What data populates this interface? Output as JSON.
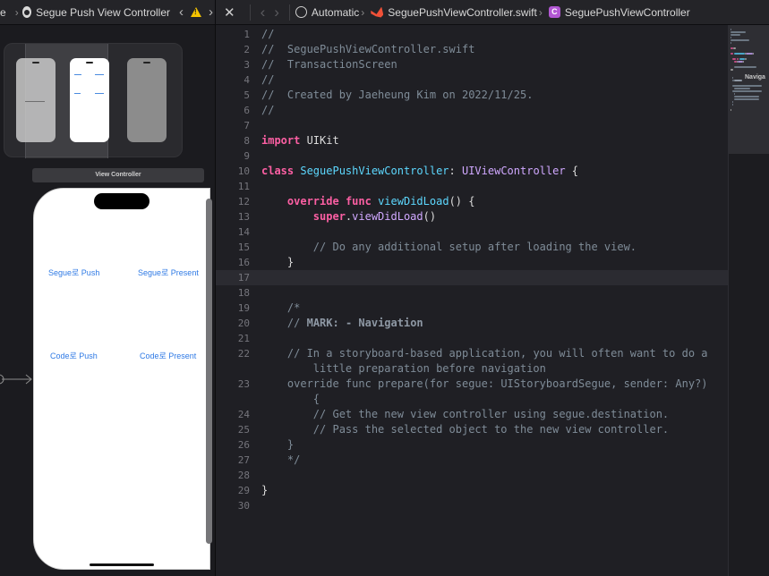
{
  "left_pane": {
    "jumpbar": {
      "prev_text": "e",
      "title": "Segue Push View Controller"
    },
    "vc_title": "View Controller",
    "buttons": {
      "segue_push": "Segue로 Push",
      "segue_present": "Segue로 Present",
      "code_push": "Code로 Push",
      "code_present": "Code로 Present"
    }
  },
  "editor": {
    "breadcrumb": {
      "scheme": "Automatic",
      "file": "SeguePushViewController.swift",
      "class_icon_letter": "C",
      "symbol": "SeguePushViewController"
    },
    "current_line": 17,
    "lines": [
      {
        "n": "1",
        "tokens": [
          {
            "c": "comment",
            "t": "//"
          }
        ]
      },
      {
        "n": "2",
        "tokens": [
          {
            "c": "comment",
            "t": "//  SeguePushViewController.swift"
          }
        ]
      },
      {
        "n": "3",
        "tokens": [
          {
            "c": "comment",
            "t": "//  TransactionScreen"
          }
        ]
      },
      {
        "n": "4",
        "tokens": [
          {
            "c": "comment",
            "t": "//"
          }
        ]
      },
      {
        "n": "5",
        "tokens": [
          {
            "c": "comment",
            "t": "//  Created by Jaeheung Kim on 2022/11/25."
          }
        ]
      },
      {
        "n": "6",
        "tokens": [
          {
            "c": "comment",
            "t": "//"
          }
        ]
      },
      {
        "n": "7",
        "tokens": []
      },
      {
        "n": "8",
        "tokens": [
          {
            "c": "keyword",
            "t": "import"
          },
          {
            "c": "plain",
            "t": " UIKit"
          }
        ]
      },
      {
        "n": "9",
        "tokens": []
      },
      {
        "n": "10",
        "tokens": [
          {
            "c": "keyword",
            "t": "class"
          },
          {
            "c": "plain",
            "t": " "
          },
          {
            "c": "class",
            "t": "SeguePushViewController"
          },
          {
            "c": "plain",
            "t": ": "
          },
          {
            "c": "type",
            "t": "UIViewController"
          },
          {
            "c": "plain",
            "t": " {"
          }
        ]
      },
      {
        "n": "11",
        "tokens": []
      },
      {
        "n": "12",
        "tokens": [
          {
            "c": "plain",
            "t": "    "
          },
          {
            "c": "keyword",
            "t": "override"
          },
          {
            "c": "plain",
            "t": " "
          },
          {
            "c": "keyword",
            "t": "func"
          },
          {
            "c": "plain",
            "t": " "
          },
          {
            "c": "class",
            "t": "viewDidLoad"
          },
          {
            "c": "plain",
            "t": "() {"
          }
        ]
      },
      {
        "n": "13",
        "tokens": [
          {
            "c": "plain",
            "t": "        "
          },
          {
            "c": "keyword",
            "t": "super"
          },
          {
            "c": "plain",
            "t": "."
          },
          {
            "c": "type",
            "t": "viewDidLoad"
          },
          {
            "c": "plain",
            "t": "()"
          }
        ]
      },
      {
        "n": "14",
        "tokens": []
      },
      {
        "n": "15",
        "tokens": [
          {
            "c": "plain",
            "t": "        "
          },
          {
            "c": "comment",
            "t": "// Do any additional setup after loading the view."
          }
        ]
      },
      {
        "n": "16",
        "tokens": [
          {
            "c": "plain",
            "t": "    }"
          }
        ]
      },
      {
        "n": "17",
        "tokens": []
      },
      {
        "n": "18",
        "tokens": []
      },
      {
        "n": "19",
        "tokens": [
          {
            "c": "plain",
            "t": "    "
          },
          {
            "c": "comment",
            "t": "/*"
          }
        ]
      },
      {
        "n": "20",
        "tokens": [
          {
            "c": "plain",
            "t": "    "
          },
          {
            "c": "comment",
            "t": "// "
          },
          {
            "c": "mark",
            "t": "MARK: - Navigation"
          }
        ]
      },
      {
        "n": "21",
        "tokens": []
      },
      {
        "n": "22",
        "tokens": [
          {
            "c": "plain",
            "t": "    "
          },
          {
            "c": "comment",
            "t": "// In a storyboard-based application, you will often want to do a"
          }
        ]
      },
      {
        "n": "",
        "tokens": [
          {
            "c": "plain",
            "t": "        "
          },
          {
            "c": "comment",
            "t": "little preparation before navigation"
          }
        ]
      },
      {
        "n": "23",
        "tokens": [
          {
            "c": "plain",
            "t": "    "
          },
          {
            "c": "comment",
            "t": "override func prepare(for segue: UIStoryboardSegue, sender: Any?)"
          }
        ]
      },
      {
        "n": "",
        "tokens": [
          {
            "c": "plain",
            "t": "        "
          },
          {
            "c": "comment",
            "t": "{"
          }
        ]
      },
      {
        "n": "24",
        "tokens": [
          {
            "c": "plain",
            "t": "        "
          },
          {
            "c": "comment",
            "t": "// Get the new view controller using segue.destination."
          }
        ]
      },
      {
        "n": "25",
        "tokens": [
          {
            "c": "plain",
            "t": "        "
          },
          {
            "c": "comment",
            "t": "// Pass the selected object to the new view controller."
          }
        ]
      },
      {
        "n": "26",
        "tokens": [
          {
            "c": "plain",
            "t": "    "
          },
          {
            "c": "comment",
            "t": "}"
          }
        ]
      },
      {
        "n": "27",
        "tokens": [
          {
            "c": "plain",
            "t": "    "
          },
          {
            "c": "comment",
            "t": "*/"
          }
        ]
      },
      {
        "n": "28",
        "tokens": []
      },
      {
        "n": "29",
        "tokens": [
          {
            "c": "plain",
            "t": "}"
          }
        ]
      },
      {
        "n": "30",
        "tokens": []
      }
    ],
    "minimap": {
      "mark_label": "Naviga"
    }
  },
  "colors": {
    "keyword": "#fc5fa3",
    "comment": "#7f8c98",
    "class_name": "#5dd8ff",
    "type_name": "#d0a8ff",
    "ios_button": "#2f7ae5",
    "warning": "#f5c400"
  }
}
